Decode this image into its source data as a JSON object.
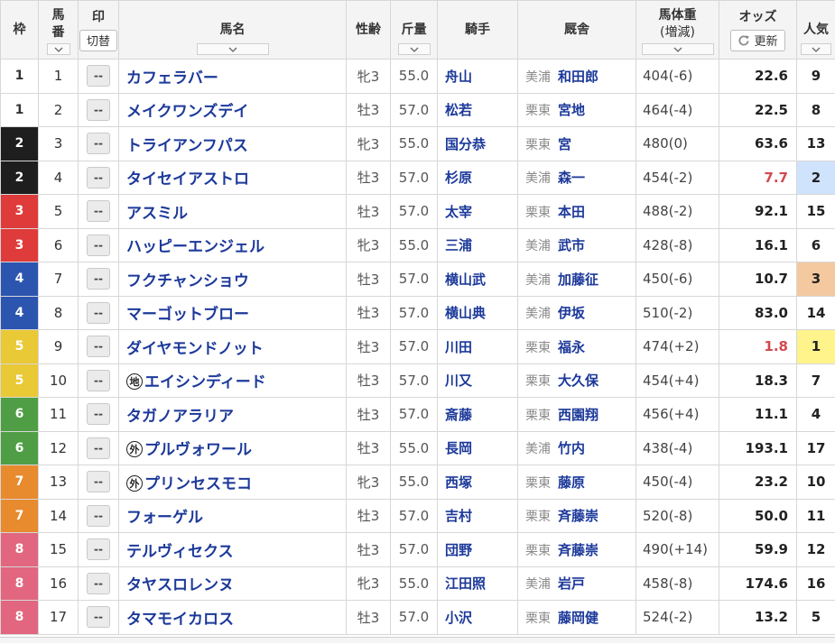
{
  "header": {
    "waku": "枠",
    "umaban_top": "馬",
    "umaban_bottom": "番",
    "mark": "印",
    "mark_toggle": "切替",
    "horse_name": "馬名",
    "sex_age": "性齢",
    "weight_carried": "斤量",
    "jockey": "騎手",
    "trainer": "厩舎",
    "body_weight": "馬体重",
    "body_weight_change": "(増減)",
    "odds": "オッズ",
    "odds_refresh": "更新",
    "popularity": "人気"
  },
  "icons": {
    "sort": "chevron-down-icon",
    "refresh": "refresh-icon"
  },
  "colors": {
    "link": "#1c399a",
    "odds_low": "#d2494f",
    "waku": {
      "1": {
        "bg": "#ffffff",
        "fg": "#333333"
      },
      "2": {
        "bg": "#1e1e1e",
        "fg": "#ffffff"
      },
      "3": {
        "bg": "#df3b3b",
        "fg": "#ffffff"
      },
      "4": {
        "bg": "#2c55b0",
        "fg": "#ffffff"
      },
      "5": {
        "bg": "#e9c935",
        "fg": "#ffffff"
      },
      "6": {
        "bg": "#4f9e45",
        "fg": "#ffffff"
      },
      "7": {
        "bg": "#e88a2e",
        "fg": "#ffffff"
      },
      "8": {
        "bg": "#e2667f",
        "fg": "#ffffff"
      }
    },
    "popularity": {
      "1": "#fff38c",
      "2": "#cfe3fd",
      "3": "#f5c9a0"
    }
  },
  "rows": [
    {
      "waku": "1",
      "umaban": "1",
      "mark": "--",
      "name": "カフェラバー",
      "sex_age": "牝3",
      "weight_carried": "55.0",
      "jockey": "舟山",
      "stable_region": "美浦",
      "trainer": "和田郎",
      "body_weight": "404(-6)",
      "odds": "22.6",
      "popularity": "9"
    },
    {
      "waku": "1",
      "umaban": "2",
      "mark": "--",
      "name": "メイクワンズデイ",
      "sex_age": "牡3",
      "weight_carried": "57.0",
      "jockey": "松若",
      "stable_region": "栗東",
      "trainer": "宮地",
      "body_weight": "464(-4)",
      "odds": "22.5",
      "popularity": "8"
    },
    {
      "waku": "2",
      "umaban": "3",
      "mark": "--",
      "name": "トライアンフパス",
      "sex_age": "牝3",
      "weight_carried": "55.0",
      "jockey": "国分恭",
      "stable_region": "栗東",
      "trainer": "宮",
      "body_weight": "480(0)",
      "odds": "63.6",
      "popularity": "13"
    },
    {
      "waku": "2",
      "umaban": "4",
      "mark": "--",
      "name": "タイセイアストロ",
      "sex_age": "牡3",
      "weight_carried": "57.0",
      "jockey": "杉原",
      "stable_region": "美浦",
      "trainer": "森一",
      "body_weight": "454(-2)",
      "odds": "7.7",
      "popularity": "2"
    },
    {
      "waku": "3",
      "umaban": "5",
      "mark": "--",
      "name": "アスミル",
      "sex_age": "牡3",
      "weight_carried": "57.0",
      "jockey": "太宰",
      "stable_region": "栗東",
      "trainer": "本田",
      "body_weight": "488(-2)",
      "odds": "92.1",
      "popularity": "15"
    },
    {
      "waku": "3",
      "umaban": "6",
      "mark": "--",
      "name": "ハッピーエンジェル",
      "sex_age": "牝3",
      "weight_carried": "55.0",
      "jockey": "三浦",
      "stable_region": "美浦",
      "trainer": "武市",
      "body_weight": "428(-8)",
      "odds": "16.1",
      "popularity": "6"
    },
    {
      "waku": "4",
      "umaban": "7",
      "mark": "--",
      "name": "フクチャンショウ",
      "sex_age": "牡3",
      "weight_carried": "57.0",
      "jockey": "横山武",
      "stable_region": "美浦",
      "trainer": "加藤征",
      "body_weight": "450(-6)",
      "odds": "10.7",
      "popularity": "3"
    },
    {
      "waku": "4",
      "umaban": "8",
      "mark": "--",
      "name": "マーゴットブロー",
      "sex_age": "牡3",
      "weight_carried": "57.0",
      "jockey": "横山典",
      "stable_region": "美浦",
      "trainer": "伊坂",
      "body_weight": "510(-2)",
      "odds": "83.0",
      "popularity": "14"
    },
    {
      "waku": "5",
      "umaban": "9",
      "mark": "--",
      "name": "ダイヤモンドノット",
      "sex_age": "牡3",
      "weight_carried": "57.0",
      "jockey": "川田",
      "stable_region": "栗東",
      "trainer": "福永",
      "body_weight": "474(+2)",
      "odds": "1.8",
      "popularity": "1"
    },
    {
      "waku": "5",
      "umaban": "10",
      "mark": "--",
      "prefix": "地",
      "name": "エイシンディード",
      "sex_age": "牡3",
      "weight_carried": "57.0",
      "jockey": "川又",
      "stable_region": "栗東",
      "trainer": "大久保",
      "body_weight": "454(+4)",
      "odds": "18.3",
      "popularity": "7"
    },
    {
      "waku": "6",
      "umaban": "11",
      "mark": "--",
      "name": "タガノアラリア",
      "sex_age": "牡3",
      "weight_carried": "57.0",
      "jockey": "斎藤",
      "stable_region": "栗東",
      "trainer": "西園翔",
      "body_weight": "456(+4)",
      "odds": "11.1",
      "popularity": "4"
    },
    {
      "waku": "6",
      "umaban": "12",
      "mark": "--",
      "prefix": "外",
      "name": "プルヴォワール",
      "sex_age": "牡3",
      "weight_carried": "55.0",
      "jockey": "長岡",
      "stable_region": "美浦",
      "trainer": "竹内",
      "body_weight": "438(-4)",
      "odds": "193.1",
      "popularity": "17"
    },
    {
      "waku": "7",
      "umaban": "13",
      "mark": "--",
      "prefix": "外",
      "name": "プリンセスモコ",
      "sex_age": "牝3",
      "weight_carried": "55.0",
      "jockey": "西塚",
      "stable_region": "栗東",
      "trainer": "藤原",
      "body_weight": "450(-4)",
      "odds": "23.2",
      "popularity": "10"
    },
    {
      "waku": "7",
      "umaban": "14",
      "mark": "--",
      "name": "フォーゲル",
      "sex_age": "牡3",
      "weight_carried": "57.0",
      "jockey": "吉村",
      "stable_region": "栗東",
      "trainer": "斉藤崇",
      "body_weight": "520(-8)",
      "odds": "50.0",
      "popularity": "11"
    },
    {
      "waku": "8",
      "umaban": "15",
      "mark": "--",
      "name": "テルヴィセクス",
      "sex_age": "牡3",
      "weight_carried": "57.0",
      "jockey": "団野",
      "stable_region": "栗東",
      "trainer": "斉藤崇",
      "body_weight": "490(+14)",
      "odds": "59.9",
      "popularity": "12"
    },
    {
      "waku": "8",
      "umaban": "16",
      "mark": "--",
      "name": "タヤスロレンヌ",
      "sex_age": "牝3",
      "weight_carried": "55.0",
      "jockey": "江田照",
      "stable_region": "美浦",
      "trainer": "岩戸",
      "body_weight": "458(-8)",
      "odds": "174.6",
      "popularity": "16"
    },
    {
      "waku": "8",
      "umaban": "17",
      "mark": "--",
      "name": "タマモイカロス",
      "sex_age": "牡3",
      "weight_carried": "57.0",
      "jockey": "小沢",
      "stable_region": "栗東",
      "trainer": "藤岡健",
      "body_weight": "524(-2)",
      "odds": "13.2",
      "popularity": "5"
    }
  ]
}
